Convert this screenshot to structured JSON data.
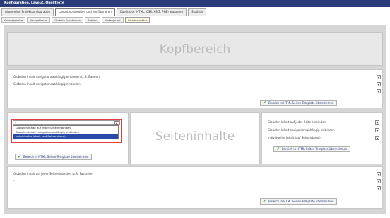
{
  "window": {
    "title": "Konfiguration, Layout, Quelltexte"
  },
  "tabs": [
    {
      "label": "Allgemeine Projektkonfiguration",
      "active": false
    },
    {
      "label": "Layout vorbereiten und konfigurieren",
      "active": true
    },
    {
      "label": "Quelltexte (HTML, CSS, XSLT, PHP) anpassen",
      "active": false
    },
    {
      "label": "Statistik",
      "active": false
    }
  ],
  "subtabs": [
    {
      "label": "Grundgehalte",
      "active": false
    },
    {
      "label": "Navigationen",
      "active": false
    },
    {
      "label": "Globale Funktionen",
      "active": false
    },
    {
      "label": "Breiten",
      "active": false
    },
    {
      "label": "Hintergrund",
      "active": false
    },
    {
      "label": "Inhaltsstruktur",
      "active": true
    }
  ],
  "header": {
    "title": "Kopfbereich"
  },
  "top_block": {
    "rows": [
      "Globalen Inhalt navigationsabhängig einbinden (z.B. Banner)",
      "Globalen Inhalt navigationsabhängig einbinden",
      "-"
    ],
    "apply_label": "Bereich in HTML Seiten-Template übernehmen"
  },
  "left_block": {
    "dropdown_value": "-",
    "options": [
      {
        "label": "Globalen Inhalt auf jeder Seite einbinden",
        "selected": false
      },
      {
        "label": "Globalen Inhalt navigationsabhängig einbinden",
        "selected": false
      },
      {
        "label": "Individueller Inhalt (auf Seitenebene)",
        "selected": true
      }
    ],
    "apply_label": "Bereich in HTML Seiten-Template übernehmen"
  },
  "center_block": {
    "title": "Seiteninhalte"
  },
  "right_block": {
    "rows": [
      "Globalen Inhalt auf jeder Seite einbinden",
      "Globalen Inhalt navigationsabhängig einbinden",
      "Individueller Inhalt (auf Seitenebene)"
    ],
    "apply_label": "Bereich in HTML Seiten-Template übernehmen"
  },
  "bottom_block": {
    "rows": [
      "Globalen Inhalt auf jeder Seite einbinden (z.B. Fusszeile)",
      "-",
      "-"
    ],
    "apply_label": "Bereich in HTML Seiten-Template übernehmen"
  },
  "colors": {
    "titlebar": "#2a3c7a",
    "selection": "#2a4aa8",
    "highlight_border": "#e04040",
    "check": "#3a9a2a"
  },
  "icons": {
    "dropdown_arrow": "chevron-down-icon",
    "apply": "check-icon"
  }
}
